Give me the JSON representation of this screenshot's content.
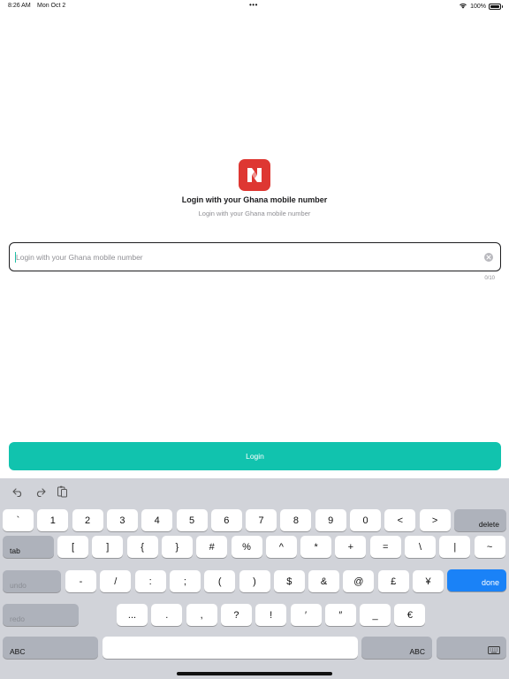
{
  "status_bar": {
    "time": "8:26 AM",
    "date": "Mon Oct 2",
    "dots": "•••",
    "battery": "100%",
    "battery_level": 1.0,
    "icons": [
      "wifi-icon",
      "battery-icon"
    ]
  },
  "login": {
    "logo_icon": "app-logo-icon",
    "title": "Login with your Ghana mobile number",
    "subtitle": "Login with your Ghana mobile number",
    "phone_placeholder": "Login with your Ghana mobile number",
    "phone_value": "",
    "char_count": "0/10",
    "button_label": "Login"
  },
  "colors": {
    "accent": "#11c3ae",
    "logo": "#de3732",
    "keyboard_bg": "#d1d3d9",
    "done_key": "#1a82f7"
  },
  "keyboard": {
    "toolbar_icons": [
      "undo-icon",
      "redo-icon",
      "paste-icon"
    ],
    "row1": [
      "`",
      "1",
      "2",
      "3",
      "4",
      "5",
      "6",
      "7",
      "8",
      "9",
      "0",
      "<",
      ">"
    ],
    "row1_end": "delete",
    "row2_start": "tab",
    "row2": [
      "[",
      "]",
      "{",
      "}",
      "#",
      "%",
      "^",
      "*",
      "+",
      "=",
      "\\",
      "|",
      "~"
    ],
    "row3_start": "undo",
    "row3": [
      "-",
      "/",
      ":",
      ";",
      "(",
      ")",
      "$",
      "&",
      "@",
      "£",
      "¥"
    ],
    "row3_end": "done",
    "row4_start": "redo",
    "row4": [
      "...",
      ".",
      ",",
      "?",
      "!",
      "′",
      "″",
      "_",
      "€"
    ],
    "row5_left": "ABC",
    "row5_right": "ABC",
    "row5_icons": [
      "keyboard-dismiss-icon"
    ]
  }
}
